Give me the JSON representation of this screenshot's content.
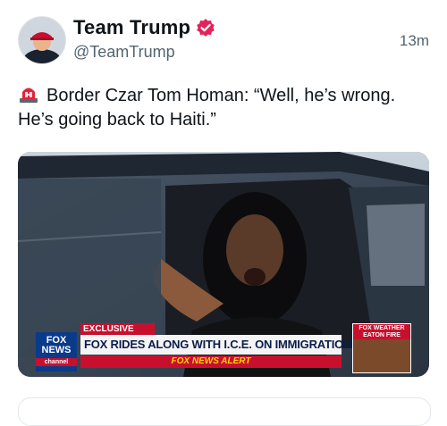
{
  "account": {
    "display_name": "Team Trump",
    "handle": "@TeamTrump",
    "verified_icon": "verified-badge-icon",
    "avatar_icon": "profile-avatar"
  },
  "post": {
    "timestamp": "13m",
    "text": "Border Czar Tom Homan: “Well, he’s wrong. He’s going back to Haiti.”",
    "emoji_icon": "siren-icon"
  },
  "media": {
    "chyron_exclusive": "EXCLUSIVE",
    "chyron_headline": "FOX RIDES ALONG WITH I.C.E. ON IMMIGRATION RAIDS",
    "chyron_alert": "FOX NEWS ALERT",
    "logo_fox": "FOX",
    "logo_news": "NEWS",
    "logo_channel": "channel",
    "weather_title": "FOX WEATHER",
    "weather_subtitle": "EATON FIRE"
  },
  "colors": {
    "verified_badge": "#e0245e",
    "fox_red": "#c8102e",
    "fox_blue": "#0a3a8a",
    "secondary_text": "#536471"
  }
}
